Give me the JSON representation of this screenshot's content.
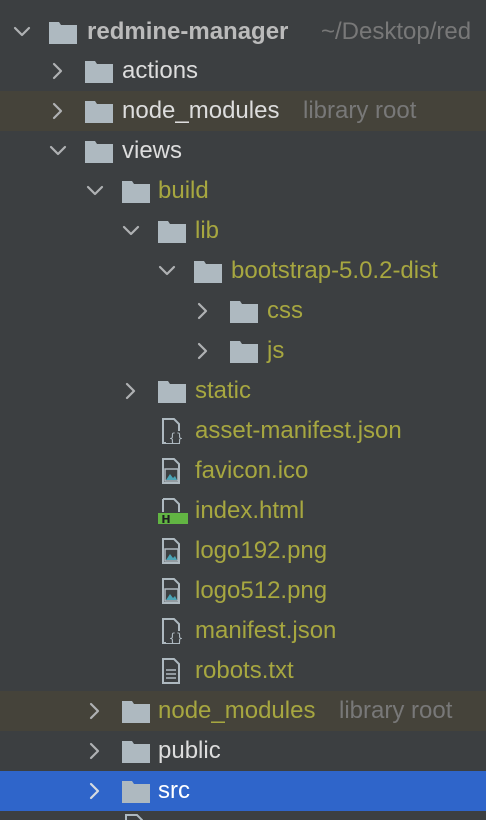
{
  "project_tree": {
    "root": {
      "name": "redmine-manager",
      "path": "~/Desktop/red"
    },
    "library_root_label": "library root",
    "items": [
      {
        "name": "actions"
      },
      {
        "name": "node_modules"
      },
      {
        "name": "views"
      },
      {
        "name": "build"
      },
      {
        "name": "lib"
      },
      {
        "name": "bootstrap-5.0.2-dist"
      },
      {
        "name": "css"
      },
      {
        "name": "js"
      },
      {
        "name": "static"
      },
      {
        "name": "asset-manifest.json"
      },
      {
        "name": "favicon.ico"
      },
      {
        "name": "index.html"
      },
      {
        "name": "logo192.png"
      },
      {
        "name": "logo512.png"
      },
      {
        "name": "manifest.json"
      },
      {
        "name": "robots.txt"
      },
      {
        "name": "node_modules"
      },
      {
        "name": "public"
      },
      {
        "name": "src"
      }
    ]
  },
  "colors": {
    "panel_background": "#3c3f41",
    "selection": "#2f65ca",
    "library_root_row": "#45433a",
    "modified_file_text": "#a7a740",
    "default_text": "#bbbbbb",
    "folder_icon": "#aeb9c0",
    "html_badge": "#62b543"
  }
}
